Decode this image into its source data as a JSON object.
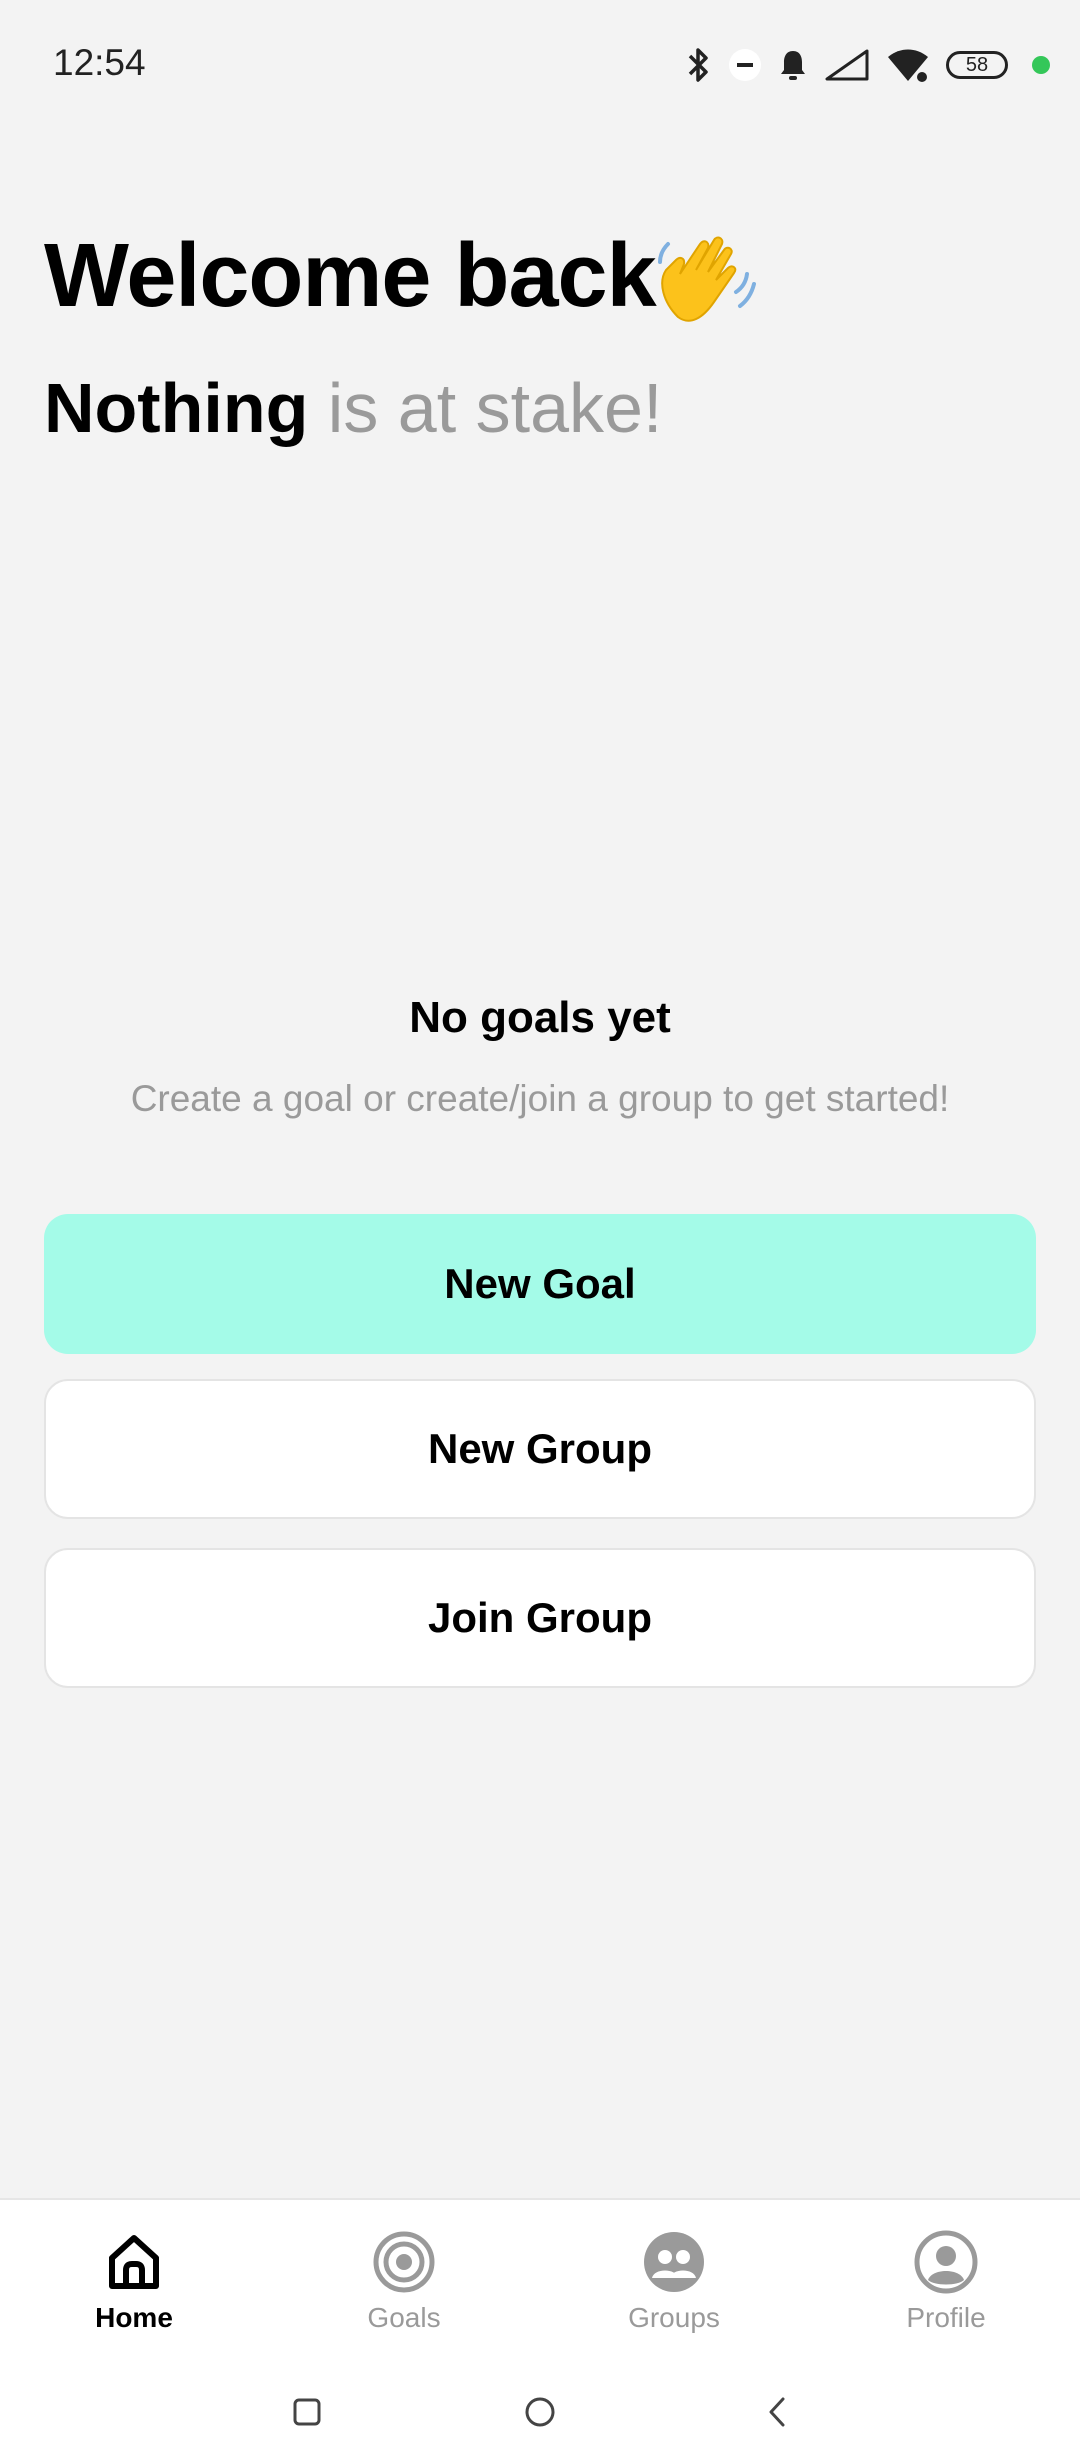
{
  "status_bar": {
    "time": "12:54",
    "battery": "58",
    "icons": [
      "bluetooth-icon",
      "dnd-icon",
      "bell-icon",
      "signal-icon",
      "wifi-icon",
      "battery-icon"
    ],
    "dot_color": "#34c759"
  },
  "header": {
    "welcome": "Welcome back",
    "emoji": "waving-hand-icon",
    "stake_strong": "Nothing",
    "stake_rest": " is at stake!"
  },
  "empty_state": {
    "title": "No goals yet",
    "subtitle": "Create a goal or create/join a group to get started!"
  },
  "actions": {
    "new_goal": "New Goal",
    "new_group": "New Group",
    "join_group": "Join Group",
    "primary_color": "#a4fbe8"
  },
  "bottom_nav": {
    "items": [
      {
        "label": "Home",
        "icon": "home-icon",
        "active": true
      },
      {
        "label": "Goals",
        "icon": "target-icon",
        "active": false
      },
      {
        "label": "Groups",
        "icon": "groups-icon",
        "active": false
      },
      {
        "label": "Profile",
        "icon": "profile-icon",
        "active": false
      }
    ]
  },
  "system_nav": {
    "icons": [
      "recents-icon",
      "home-circle-icon",
      "back-icon"
    ]
  }
}
